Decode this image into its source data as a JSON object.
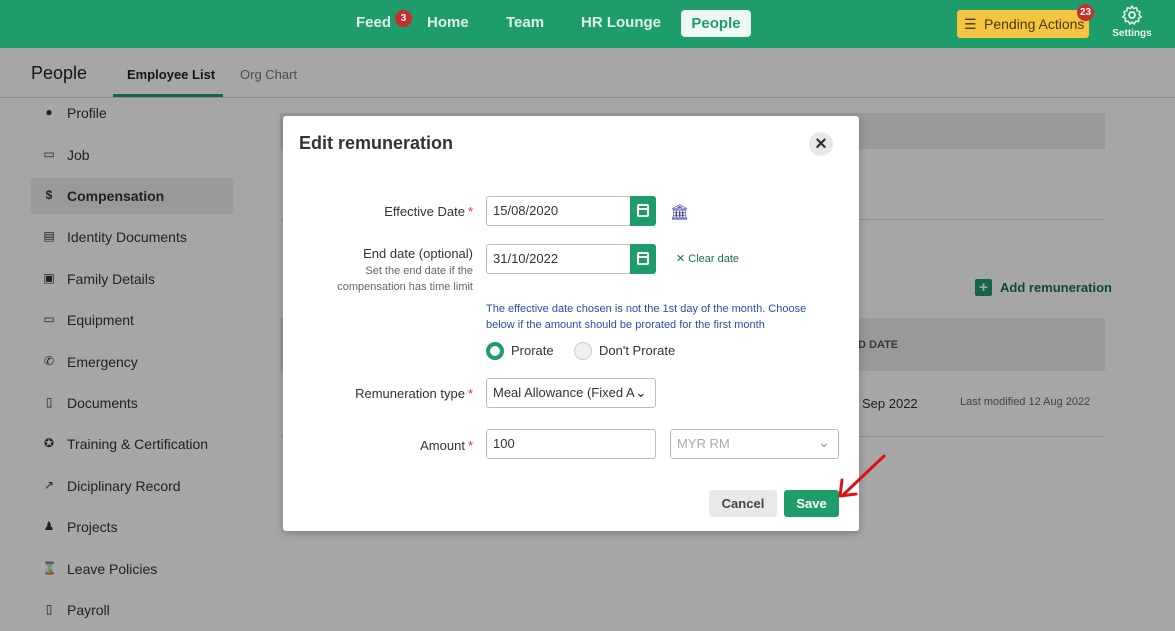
{
  "topnav": {
    "feed": "Feed",
    "feed_badge": "3",
    "home": "Home",
    "team": "Team",
    "hr_lounge": "HR Lounge",
    "people": "People",
    "pending_actions": "Pending Actions",
    "pending_badge": "23",
    "settings": "Settings"
  },
  "subheader": {
    "title": "People",
    "tabs": [
      "Employee List",
      "Org Chart"
    ]
  },
  "sidebar": {
    "items": [
      {
        "label": "Profile",
        "icon": "person-icon"
      },
      {
        "label": "Job",
        "icon": "briefcase-icon"
      },
      {
        "label": "Compensation",
        "icon": "money-bag-icon"
      },
      {
        "label": "Identity Documents",
        "icon": "id-card-icon"
      },
      {
        "label": "Family Details",
        "icon": "family-icon"
      },
      {
        "label": "Equipment",
        "icon": "laptop-icon"
      },
      {
        "label": "Emergency",
        "icon": "phone-icon"
      },
      {
        "label": "Documents",
        "icon": "document-icon"
      },
      {
        "label": "Training & Certification",
        "icon": "award-icon"
      },
      {
        "label": "Diciplinary Record",
        "icon": "chart-icon"
      },
      {
        "label": "Projects",
        "icon": "projects-icon"
      },
      {
        "label": "Leave Policies",
        "icon": "leave-icon"
      },
      {
        "label": "Payroll",
        "icon": "payroll-icon"
      }
    ]
  },
  "background": {
    "add_remuneration": "Add remuneration",
    "col_end_date": "D DATE",
    "row_end_date": "Sep 2022",
    "row_modified": "Last modified 12 Aug 2022"
  },
  "modal": {
    "title": "Edit remuneration",
    "effective_date_label": "Effective Date",
    "effective_date_value": "15/08/2020",
    "end_date_label": "End date (optional)",
    "end_date_help_1": "Set the end date if the",
    "end_date_help_2": "compensation has time limit",
    "end_date_value": "31/10/2022",
    "clear_date": "Clear date",
    "notice_1": "The effective date chosen is not the 1st day of the month. Choose",
    "notice_2": "below if the amount should be prorated for the first month",
    "prorate": "Prorate",
    "dont_prorate": "Don't Prorate",
    "remuneration_type_label": "Remuneration type",
    "remuneration_type_value": "Meal Allowance (Fixed A",
    "amount_label": "Amount",
    "amount_value": "100",
    "currency_value": "MYR RM",
    "required_mark": "*",
    "cancel": "Cancel",
    "save": "Save"
  },
  "colors": {
    "brand": "#1e9d6a",
    "badge": "#c62f2f",
    "pending": "#f5c542",
    "annotation_arrow": "#e01010"
  }
}
